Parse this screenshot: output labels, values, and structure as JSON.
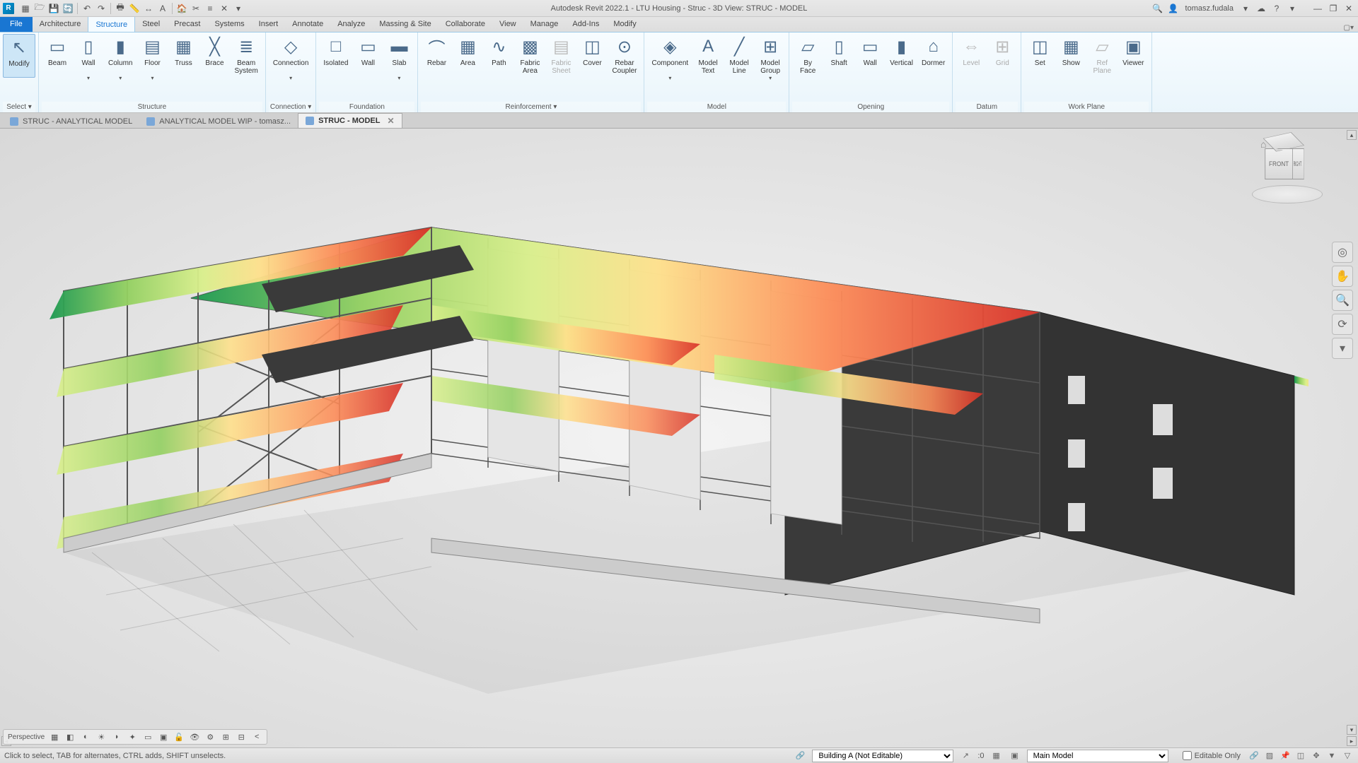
{
  "app_title": "Autodesk Revit 2022.1 - LTU Housing - Struc - 3D View: STRUC - MODEL",
  "user_name": "tomasz.fudala",
  "file_tab": "File",
  "ribbon_tabs": [
    "Architecture",
    "Structure",
    "Steel",
    "Precast",
    "Systems",
    "Insert",
    "Annotate",
    "Analyze",
    "Massing & Site",
    "Collaborate",
    "View",
    "Manage",
    "Add-Ins",
    "Modify"
  ],
  "active_tab_index": 1,
  "panels": {
    "select": {
      "title": "Select ▾",
      "buttons": [
        {
          "label": "Modify",
          "icon": "↖"
        }
      ]
    },
    "structure": {
      "title": "Structure",
      "buttons": [
        {
          "label": "Beam",
          "icon": "▭"
        },
        {
          "label": "Wall",
          "icon": "▯",
          "drop": true
        },
        {
          "label": "Column",
          "icon": "▮",
          "drop": true
        },
        {
          "label": "Floor",
          "icon": "▤",
          "drop": true
        },
        {
          "label": "Truss",
          "icon": "▦"
        },
        {
          "label": "Brace",
          "icon": "╳"
        },
        {
          "label": "Beam System",
          "icon": "≣"
        }
      ]
    },
    "connection": {
      "title": "Connection ▾",
      "buttons": [
        {
          "label": "Connection",
          "icon": "◇",
          "drop": true
        }
      ]
    },
    "foundation": {
      "title": "Foundation",
      "buttons": [
        {
          "label": "Isolated",
          "icon": "□"
        },
        {
          "label": "Wall",
          "icon": "▭"
        },
        {
          "label": "Slab",
          "icon": "▬",
          "drop": true
        }
      ]
    },
    "reinforcement": {
      "title": "Reinforcement ▾",
      "buttons": [
        {
          "label": "Rebar",
          "icon": "⌒"
        },
        {
          "label": "Area",
          "icon": "▦"
        },
        {
          "label": "Path",
          "icon": "∿"
        },
        {
          "label": "Fabric Area",
          "icon": "▩"
        },
        {
          "label": "Fabric Sheet",
          "icon": "▤",
          "disabled": true
        },
        {
          "label": "Cover",
          "icon": "◫"
        },
        {
          "label": "Rebar Coupler",
          "icon": "⊙"
        }
      ]
    },
    "model": {
      "title": "Model",
      "buttons": [
        {
          "label": "Component",
          "icon": "◈",
          "drop": true
        },
        {
          "label": "Model Text",
          "icon": "A"
        },
        {
          "label": "Model Line",
          "icon": "╱"
        },
        {
          "label": "Model Group",
          "icon": "⊞",
          "drop": true
        }
      ]
    },
    "opening": {
      "title": "Opening",
      "buttons": [
        {
          "label": "By Face",
          "icon": "▱"
        },
        {
          "label": "Shaft",
          "icon": "▯"
        },
        {
          "label": "Wall",
          "icon": "▭"
        },
        {
          "label": "Vertical",
          "icon": "▮"
        },
        {
          "label": "Dormer",
          "icon": "⌂"
        }
      ]
    },
    "datum": {
      "title": "Datum",
      "buttons": [
        {
          "label": "Level",
          "icon": "⇔",
          "disabled": true
        },
        {
          "label": "Grid",
          "icon": "⊞",
          "disabled": true
        }
      ]
    },
    "workplane": {
      "title": "Work Plane",
      "buttons": [
        {
          "label": "Set",
          "icon": "◫"
        },
        {
          "label": "Show",
          "icon": "▦"
        },
        {
          "label": "Ref Plane",
          "icon": "▱",
          "disabled": true
        },
        {
          "label": "Viewer",
          "icon": "▣"
        }
      ]
    }
  },
  "view_tabs": [
    {
      "label": "STRUC - ANALYTICAL MODEL",
      "active": false
    },
    {
      "label": "ANALYTICAL MODEL WIP - tomasz...",
      "active": false
    },
    {
      "label": "STRUC - MODEL",
      "active": true
    }
  ],
  "viewcube": {
    "front": "FRONT",
    "right": "RIGHT"
  },
  "vcb_mode": "Perspective",
  "status_hint": "Click to select, TAB for alternates, CTRL adds, SHIFT unselects.",
  "status_workset": "Building A (Not Editable)",
  "status_mainmodel": "Main Model",
  "status_editable": "Editable Only",
  "status_count": ":0"
}
